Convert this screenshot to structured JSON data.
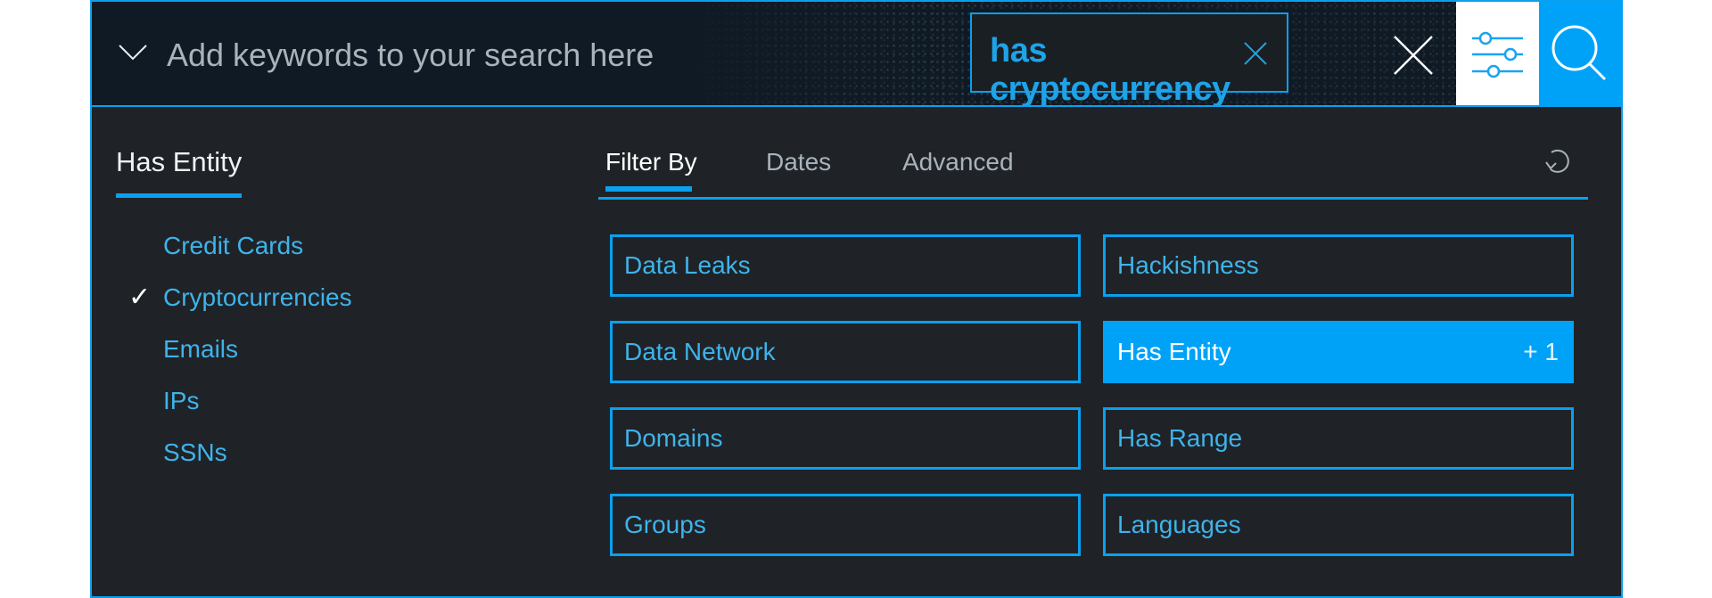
{
  "colors": {
    "accent": "#0aa0f0",
    "panel_bg": "#1f2327",
    "header_bg": "#0f1a24",
    "active_cell": "#00a2f8"
  },
  "header": {
    "expand_icon": "chevron-down-icon",
    "search_placeholder": "Add keywords to your search here",
    "search_value": "",
    "active_chip": {
      "label": "has cryptocurrency",
      "remove_icon": "close-icon"
    },
    "clear_icon": "close-icon",
    "filter_icon": "sliders-icon",
    "search_icon": "search-icon"
  },
  "left_panel": {
    "title": "Has Entity",
    "items": [
      {
        "label": "Credit Cards",
        "checked": false
      },
      {
        "label": "Cryptocurrencies",
        "checked": true,
        "check_glyph": "✓"
      },
      {
        "label": "Emails",
        "checked": false
      },
      {
        "label": "IPs",
        "checked": false
      },
      {
        "label": "SSNs",
        "checked": false
      }
    ]
  },
  "tabs": {
    "items": [
      {
        "label": "Filter By",
        "active": true
      },
      {
        "label": "Dates",
        "active": false
      },
      {
        "label": "Advanced",
        "active": false
      }
    ],
    "reset_icon": "reset-icon"
  },
  "filters": [
    {
      "label": "Data Leaks",
      "active": false
    },
    {
      "label": "Hackishness",
      "active": false
    },
    {
      "label": "Data Network",
      "active": false
    },
    {
      "label": "Has Entity",
      "active": true,
      "count": "+ 1"
    },
    {
      "label": "Domains",
      "active": false
    },
    {
      "label": "Has Range",
      "active": false
    },
    {
      "label": "Groups",
      "active": false
    },
    {
      "label": "Languages",
      "active": false
    }
  ]
}
